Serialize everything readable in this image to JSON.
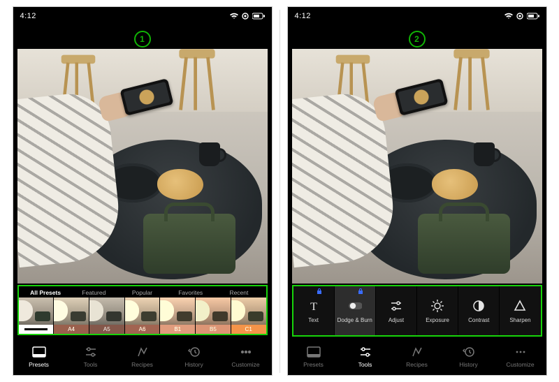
{
  "status": {
    "time": "4:12"
  },
  "markers": {
    "left": "1",
    "right": "2"
  },
  "panel1": {
    "tabs": [
      "All Presets",
      "Featured",
      "Popular",
      "Favorites",
      "Recent"
    ],
    "active_tab": 0,
    "thumbs": [
      "—",
      "A4",
      "A5",
      "A6",
      "B1",
      "B5",
      "C1"
    ]
  },
  "panel2": {
    "tools": [
      "Text",
      "Dodge & Burn",
      "Adjust",
      "Exposure",
      "Contrast",
      "Sharpen"
    ],
    "locked": [
      0,
      1
    ],
    "selected": 1
  },
  "nav": {
    "items": [
      "Presets",
      "Tools",
      "Recipes",
      "History",
      "Customize"
    ],
    "active": {
      "left": 0,
      "right": 1
    }
  },
  "icons": {
    "text": "text-tool-icon",
    "dodge": "dodge-burn-icon",
    "adjust": "adjust-icon",
    "exposure": "exposure-icon",
    "contrast": "contrast-icon",
    "sharpen": "sharpen-icon",
    "presets": "presets-icon",
    "tools": "tools-icon",
    "recipes": "recipes-icon",
    "history": "history-icon",
    "custom": "customize-icon",
    "wifi": "wifi-icon",
    "battery": "battery-icon",
    "lock": "lock-icon"
  }
}
